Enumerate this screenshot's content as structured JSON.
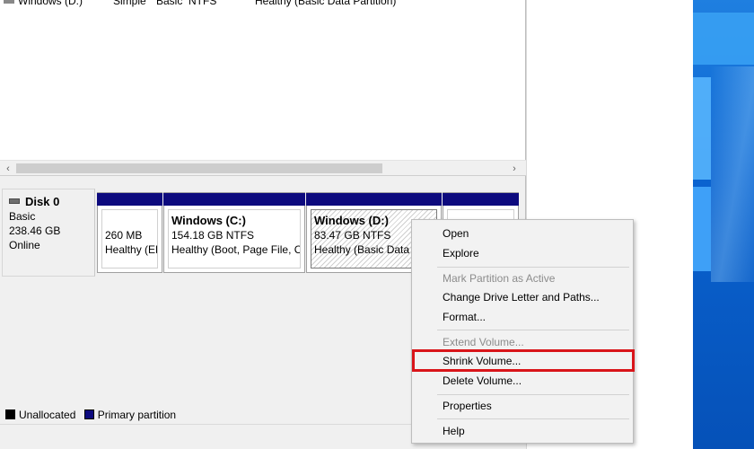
{
  "volume_list": {
    "row": {
      "volume": "Windows (D:)",
      "layout": "Simple",
      "type": "Basic",
      "file_system": "NTFS",
      "status": "Healthy (Basic Data Partition)"
    }
  },
  "scrollbar": {
    "left_arrow": "‹",
    "right_arrow": "›"
  },
  "disk": {
    "name": "Disk 0",
    "type": "Basic",
    "size": "238.46 GB",
    "state": "Online"
  },
  "partitions": [
    {
      "title": "",
      "size": "260 MB",
      "status": "Healthy (EF"
    },
    {
      "title": "Windows  (C:)",
      "size": "154.18 GB NTFS",
      "status": "Healthy (Boot, Page File, Cra"
    },
    {
      "title": "Windows  (D:)",
      "size": "83.47 GB NTFS",
      "status": "Healthy (Basic Data P"
    },
    {
      "title": "",
      "size": "",
      "status": ""
    }
  ],
  "legend": {
    "unallocated": "Unallocated",
    "primary": "Primary partition"
  },
  "context_menu": {
    "open": "Open",
    "explore": "Explore",
    "mark_active": "Mark Partition as Active",
    "change_letter": "Change Drive Letter and Paths...",
    "format": "Format...",
    "extend": "Extend Volume...",
    "shrink": "Shrink Volume...",
    "delete": "Delete Volume...",
    "properties": "Properties",
    "help": "Help"
  },
  "colors": {
    "primary_partition": "#0d0a7e",
    "highlight": "#d9151a",
    "desktop": "#0a63d0"
  }
}
